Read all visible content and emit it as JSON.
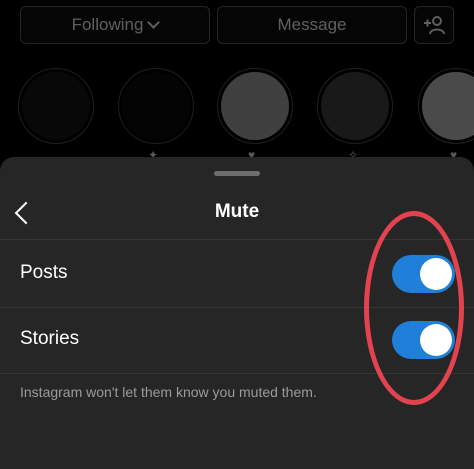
{
  "profile_actions": {
    "following_label": "Following",
    "message_label": "Message",
    "add_user_icon": "+person-icon"
  },
  "sheet": {
    "title": "Mute",
    "back_icon": "chevron-left-icon",
    "options": [
      {
        "label": "Posts",
        "enabled": true
      },
      {
        "label": "Stories",
        "enabled": true
      }
    ],
    "note": "Instagram won't let them know you muted them."
  },
  "colors": {
    "toggle_on": "#1f7fd9",
    "sheet_bg": "#262626",
    "annotation": "#e2434f"
  }
}
